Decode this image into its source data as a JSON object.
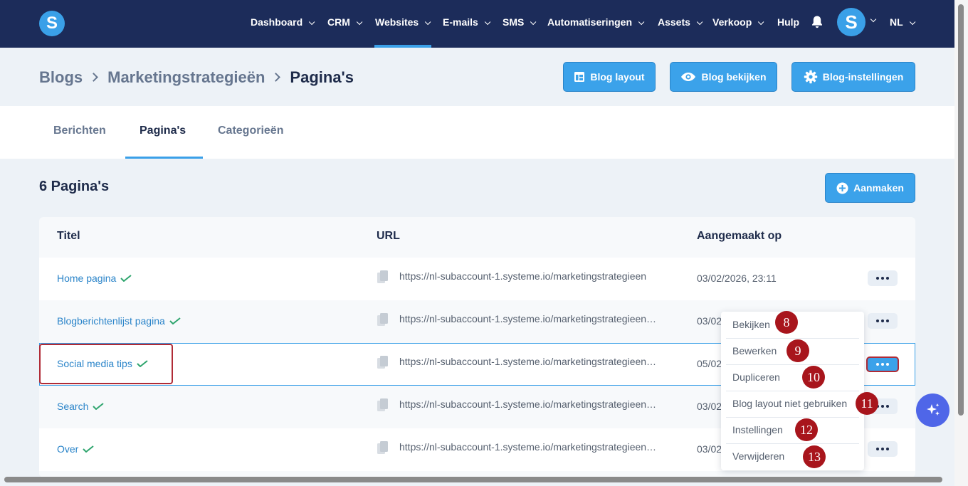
{
  "nav": {
    "items": [
      {
        "label": "Dashboard",
        "has_dropdown": true
      },
      {
        "label": "CRM",
        "has_dropdown": true
      },
      {
        "label": "Websites",
        "has_dropdown": true,
        "active": true
      },
      {
        "label": "E-mails",
        "has_dropdown": true
      },
      {
        "label": "SMS",
        "has_dropdown": true
      },
      {
        "label": "Automatiseringen",
        "has_dropdown": true
      },
      {
        "label": "Assets",
        "has_dropdown": true
      },
      {
        "label": "Verkoop",
        "has_dropdown": true
      },
      {
        "label": "Hulp",
        "has_dropdown": false
      }
    ],
    "language": "NL",
    "logo_letter": "S",
    "avatar_letter": "S"
  },
  "breadcrumb": {
    "items": [
      "Blogs",
      "Marketingstrategieën",
      "Pagina's"
    ]
  },
  "header_buttons": {
    "layout": "Blog layout",
    "view": "Blog bekijken",
    "settings": "Blog-instellingen"
  },
  "tabs": [
    {
      "label": "Berichten",
      "active": false
    },
    {
      "label": "Pagina's",
      "active": true
    },
    {
      "label": "Categorieën",
      "active": false
    }
  ],
  "list": {
    "count_title": "6 Pagina's",
    "create_button": "Aanmaken"
  },
  "table": {
    "headers": {
      "title": "Titel",
      "url": "URL",
      "created": "Aangemaakt op"
    },
    "rows": [
      {
        "title": "Home pagina",
        "url": "https://nl-subaccount-1.systeme.io/marketingstrategieen",
        "date": "03/02/2026, 23:11",
        "published": true
      },
      {
        "title": "Blogberichtenlijst pagina",
        "url": "https://nl-subaccount-1.systeme.io/marketingstrategieen…",
        "date": "03/02",
        "published": true
      },
      {
        "title": "Social media tips",
        "url": "https://nl-subaccount-1.systeme.io/marketingstrategieen…",
        "date": "05/02",
        "published": true,
        "selected": true
      },
      {
        "title": "Search",
        "url": "https://nl-subaccount-1.systeme.io/marketingstrategieen…",
        "date": "03/02",
        "published": true
      },
      {
        "title": "Over",
        "url": "https://nl-subaccount-1.systeme.io/marketingstrategieen…",
        "date": "03/02",
        "published": true
      }
    ]
  },
  "context_menu": {
    "items": [
      {
        "label": "Bekijken",
        "badge": "8"
      },
      {
        "label": "Bewerken",
        "badge": "9"
      },
      {
        "label": "Dupliceren",
        "badge": "10"
      },
      {
        "label": "Blog layout niet gebruiken",
        "badge": "11"
      },
      {
        "label": "Instellingen",
        "badge": "12"
      },
      {
        "label": "Verwijderen",
        "badge": "13"
      }
    ]
  },
  "colors": {
    "nav_bg": "#1c2c5a",
    "accent": "#3aa0e8",
    "highlight": "#b02b36",
    "badge": "#a8151c",
    "ai_button": "#4f66e8"
  }
}
